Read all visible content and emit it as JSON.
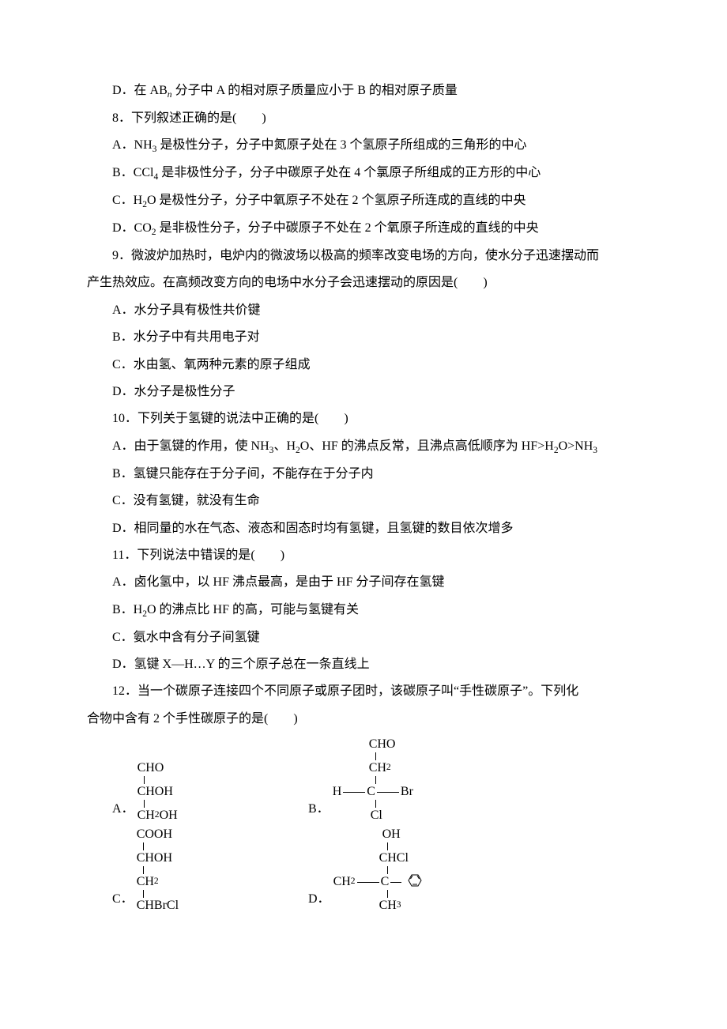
{
  "lines": {
    "dOption": "D．在 AB",
    "dOption_sub": "n",
    "dOption_tail": " 分子中 A 的相对原子质量应小于 B 的相对原子质量",
    "q8": "8．下列叙述正确的是(　　)",
    "q8A_a": "A．NH",
    "q8A_b": " 是极性分子，分子中氮原子处在 3 个氢原子所组成的三角形的中心",
    "q8B_a": "B．CCl",
    "q8B_b": " 是非极性分子，分子中碳原子处在 4 个氯原子所组成的正方形的中心",
    "q8C_a": "C．H",
    "q8C_b": "O 是极性分子，分子中氧原子不处在 2 个氢原子所连成的直线的中央",
    "q8D_a": "D．CO",
    "q8D_b": " 是非极性分子，分子中碳原子不处在 2 个氧原子所连成的直线的中央",
    "q9a": "9．微波炉加热时，电炉内的微波场以极高的频率改变电场的方向，使水分子迅速摆动而",
    "q9b": "产生热效应。在高频改变方向的电场中水分子会迅速摆动的原因是(　　)",
    "q9A": "A．水分子具有极性共价键",
    "q9B": "B．水分子中有共用电子对",
    "q9C": "C．水由氢、氧两种元素的原子组成",
    "q9D": "D．水分子是极性分子",
    "q10": "10．下列关于氢键的说法中正确的是(　　)",
    "q10A_a": "A．由于氢键的作用，使 NH",
    "q10A_b": "、H",
    "q10A_c": "O、HF 的沸点反常，且沸点高低顺序为 HF>H",
    "q10A_d": "O>NH",
    "q10B": "B．氢键只能存在于分子间，不能存在于分子内",
    "q10C": "C．没有氢键，就没有生命",
    "q10D": "D．相同量的水在气态、液态和固态时均有氢键，且氢键的数目依次增多",
    "q11": "11．下列说法中错误的是(　　)",
    "q11A": "A．卤化氢中，以 HF 沸点最高，是由于 HF 分子间存在氢键",
    "q11B_a": "B．H",
    "q11B_b": "O 的沸点比 HF 的高，可能与氢键有关",
    "q11C": "C．氨水中含有分子间氢键",
    "q11D": "D．氢键 X—H…Y 的三个原子总在一条直线上",
    "q12a": "12．当一个碳原子连接四个不同原子或原子团时，该碳原子叫“手性碳原子”。下列化",
    "q12b": "合物中含有 2 个手性碳原子的是(　　)",
    "optA": "A．",
    "optB": "B．",
    "optC": "C．",
    "optD": "D．"
  },
  "chem": {
    "A": {
      "l1": "CHO",
      "l2": "CHOH",
      "l3_a": "CH",
      "l3_b": "OH"
    },
    "B": {
      "l1": "CHO",
      "l2_a": "CH",
      "l3_pre": "H",
      "l3_mid": "C",
      "l3_post": "Br",
      "l4": "Cl"
    },
    "C": {
      "l1": "COOH",
      "l2": "CHOH",
      "l3": "CH",
      "l4": "CHBrCl"
    },
    "D": {
      "l1": "OH",
      "l2": "CHCl",
      "l3_pre": "CH",
      "l3_mid": "C",
      "l4": "CH"
    }
  }
}
